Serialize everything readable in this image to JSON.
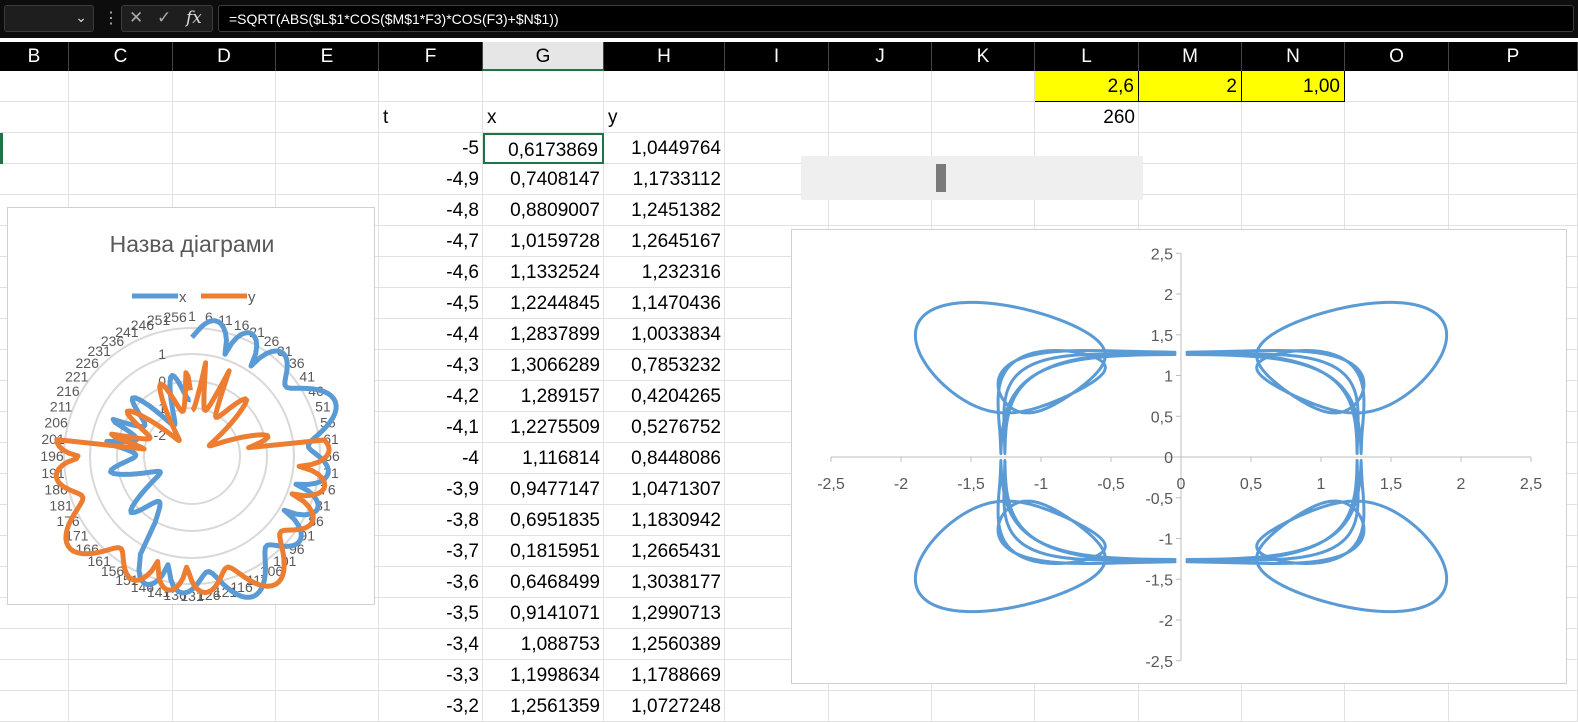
{
  "formula_bar": {
    "name_box": "",
    "formula": "=SQRT(ABS($L$1*COS($M$1*F3)*COS(F3)+$N$1))",
    "icons": [
      "chevron-down-icon",
      "more-icon",
      "cancel-icon",
      "confirm-icon",
      "fx-icon"
    ]
  },
  "columns": [
    "B",
    "C",
    "D",
    "E",
    "F",
    "G",
    "H",
    "I",
    "J",
    "K",
    "L",
    "M",
    "N",
    "O",
    "P"
  ],
  "selected_column": "G",
  "params": {
    "L1": "2,6",
    "M1": "2",
    "N1": "1,00",
    "L2": "260"
  },
  "headers": {
    "t": "t",
    "x": "x",
    "y": "y"
  },
  "rows": [
    {
      "t": "-5",
      "x": "0,6173869",
      "y": "1,0449764"
    },
    {
      "t": "-4,9",
      "x": "0,7408147",
      "y": "1,1733112"
    },
    {
      "t": "-4,8",
      "x": "0,8809007",
      "y": "1,2451382"
    },
    {
      "t": "-4,7",
      "x": "1,0159728",
      "y": "1,2645167"
    },
    {
      "t": "-4,6",
      "x": "1,1332524",
      "y": "1,232316"
    },
    {
      "t": "-4,5",
      "x": "1,2244845",
      "y": "1,1470436"
    },
    {
      "t": "-4,4",
      "x": "1,2837899",
      "y": "1,0033834"
    },
    {
      "t": "-4,3",
      "x": "1,3066289",
      "y": "0,7853232"
    },
    {
      "t": "-4,2",
      "x": "1,289157",
      "y": "0,4204265"
    },
    {
      "t": "-4,1",
      "x": "1,2275509",
      "y": "0,5276752"
    },
    {
      "t": "-4",
      "x": "1,116814",
      "y": "0,8448086"
    },
    {
      "t": "-3,9",
      "x": "0,9477147",
      "y": "1,0471307"
    },
    {
      "t": "-3,8",
      "x": "0,6951835",
      "y": "1,1830942"
    },
    {
      "t": "-3,7",
      "x": "0,1815951",
      "y": "1,2665431"
    },
    {
      "t": "-3,6",
      "x": "0,6468499",
      "y": "1,3038177"
    },
    {
      "t": "-3,5",
      "x": "0,9141071",
      "y": "1,2990713"
    },
    {
      "t": "-3,4",
      "x": "1,088753",
      "y": "1,2560389"
    },
    {
      "t": "-3,3",
      "x": "1,1998634",
      "y": "1,1788669"
    },
    {
      "t": "-3,2",
      "x": "1,2561359",
      "y": "1,0727248"
    }
  ],
  "chart_data": [
    {
      "type": "radar",
      "title": "Назва діаграми",
      "legend": "top",
      "series": [
        {
          "name": "x",
          "color": "#5b9bd5"
        },
        {
          "name": "y",
          "color": "#ed7d31"
        }
      ],
      "radial_ticks": [
        "1",
        "0",
        "-1",
        "-2"
      ],
      "category_labels_sample": [
        "1",
        "6",
        "11",
        "16",
        "21",
        "26"
      ]
    },
    {
      "type": "scatter",
      "title": "",
      "series": [
        {
          "color": "#5b9bd5"
        }
      ],
      "xlim": [
        -2.5,
        2.5
      ],
      "ylim": [
        -2.5,
        2.5
      ],
      "x_ticks": [
        "-2,5",
        "-2",
        "-1,5",
        "-1",
        "-0,5",
        "0",
        "0,5",
        "1",
        "1,5",
        "2",
        "2,5"
      ],
      "y_ticks": [
        "2,5",
        "2",
        "1,5",
        "1",
        "0,5",
        "0",
        "-0,5",
        "-1",
        "-1,5",
        "-2",
        "-2,5"
      ],
      "points_sample": [
        {
          "x": 0.6173869,
          "y": 1.0449764
        },
        {
          "x": 0.7408147,
          "y": 1.1733112
        },
        {
          "x": 0.8809007,
          "y": 1.2451382
        },
        {
          "x": 1.0159728,
          "y": 1.2645167
        },
        {
          "x": 1.1332524,
          "y": 1.232316
        },
        {
          "x": 1.2244845,
          "y": 1.1470436
        },
        {
          "x": 1.2837899,
          "y": 1.0033834
        },
        {
          "x": 1.3066289,
          "y": 0.7853232
        },
        {
          "x": 1.289157,
          "y": 0.4204265
        },
        {
          "x": 1.2275509,
          "y": 0.5276752
        },
        {
          "x": 1.116814,
          "y": 0.8448086
        },
        {
          "x": 0.9477147,
          "y": 1.0471307
        },
        {
          "x": 0.6951835,
          "y": 1.1830942
        },
        {
          "x": 0.1815951,
          "y": 1.2665431
        },
        {
          "x": 0.6468499,
          "y": 1.3038177
        },
        {
          "x": 0.9141071,
          "y": 1.2990713
        },
        {
          "x": 1.088753,
          "y": 1.2560389
        },
        {
          "x": 1.1998634,
          "y": 1.1788669
        },
        {
          "x": 1.2561359,
          "y": 1.0727248
        }
      ]
    }
  ]
}
